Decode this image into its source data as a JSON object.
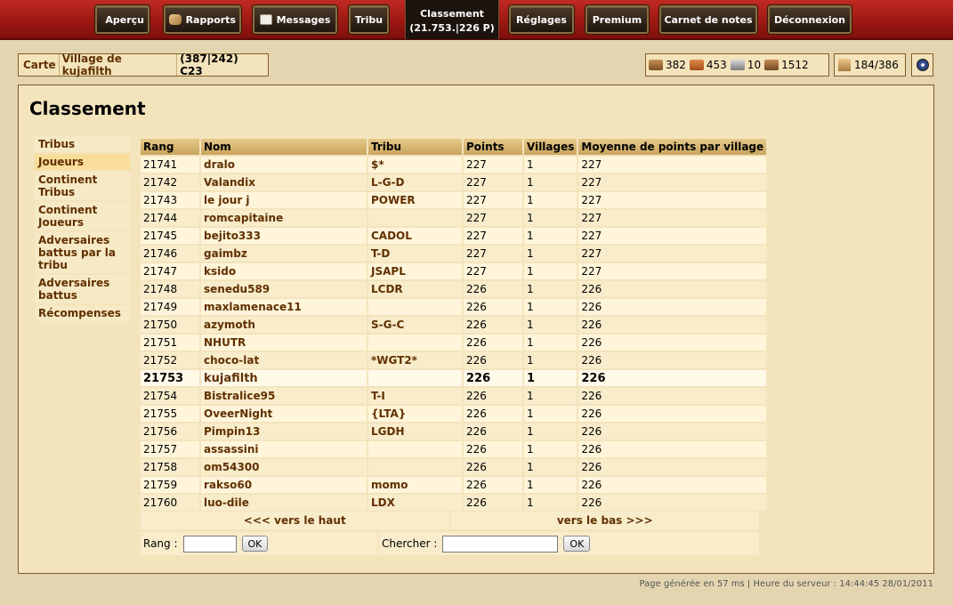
{
  "topbar": {
    "items": [
      {
        "label": "Aperçu"
      },
      {
        "label": "Rapports"
      },
      {
        "label": "Messages"
      },
      {
        "label": "Tribu"
      },
      {
        "label": "Réglages"
      },
      {
        "label": "Premium"
      },
      {
        "label": "Carnet de notes"
      },
      {
        "label": "Déconnexion"
      }
    ],
    "classement": {
      "label": "Classement",
      "sub": "(21.753.|226 P)"
    }
  },
  "village": {
    "map_label": "Carte",
    "village_name": "Village de kujafilth",
    "coords": "(387|242) C23"
  },
  "resources": {
    "wood": "382",
    "clay": "453",
    "iron": "10",
    "storage": "1512"
  },
  "population": "184/386",
  "page": {
    "title": "Classement"
  },
  "side_menu": [
    {
      "label": "Tribus"
    },
    {
      "label": "Joueurs"
    },
    {
      "label": "Continent Tribus"
    },
    {
      "label": "Continent Joueurs"
    },
    {
      "label": "Adversaires battus par la tribu"
    },
    {
      "label": "Adversaires battus"
    },
    {
      "label": "Récompenses"
    }
  ],
  "table": {
    "headers": [
      "Rang",
      "Nom",
      "Tribu",
      "Points",
      "Villages",
      "Moyenne de points par village"
    ],
    "rows": [
      [
        "21741",
        "dralo",
        "$*",
        "227",
        "1",
        "227"
      ],
      [
        "21742",
        "Valandix",
        "L-G-D",
        "227",
        "1",
        "227"
      ],
      [
        "21743",
        "le jour j",
        "POWER",
        "227",
        "1",
        "227"
      ],
      [
        "21744",
        "romcapitaine",
        "",
        "227",
        "1",
        "227"
      ],
      [
        "21745",
        "bejito333",
        "CADOL",
        "227",
        "1",
        "227"
      ],
      [
        "21746",
        "gaimbz",
        "T-D",
        "227",
        "1",
        "227"
      ],
      [
        "21747",
        "ksido",
        "JSAPL",
        "227",
        "1",
        "227"
      ],
      [
        "21748",
        "senedu589",
        "LCDR",
        "226",
        "1",
        "226"
      ],
      [
        "21749",
        "maxlamenace11",
        "",
        "226",
        "1",
        "226"
      ],
      [
        "21750",
        "azymoth",
        "S-G-C",
        "226",
        "1",
        "226"
      ],
      [
        "21751",
        "NHUTR",
        "",
        "226",
        "1",
        "226"
      ],
      [
        "21752",
        "choco-lat",
        "*WGT2*",
        "226",
        "1",
        "226"
      ],
      [
        "21753",
        "kujafilth",
        "",
        "226",
        "1",
        "226"
      ],
      [
        "21754",
        "Bistralice95",
        "T-I",
        "226",
        "1",
        "226"
      ],
      [
        "21755",
        "OveerNight",
        "{LTA}",
        "226",
        "1",
        "226"
      ],
      [
        "21756",
        "Pimpin13",
        "LGDH",
        "226",
        "1",
        "226"
      ],
      [
        "21757",
        "assassini",
        "",
        "226",
        "1",
        "226"
      ],
      [
        "21758",
        "om54300",
        "",
        "226",
        "1",
        "226"
      ],
      [
        "21759",
        "rakso60",
        "momo",
        "226",
        "1",
        "226"
      ],
      [
        "21760",
        "luo-dile",
        "LDX",
        "226",
        "1",
        "226"
      ]
    ]
  },
  "pager": {
    "up": "<<< vers le haut",
    "down": "vers le bas >>>"
  },
  "search": {
    "rank_label": "Rang :",
    "search_label": "Chercher :",
    "ok": "OK",
    "rank_value": "",
    "search_value": ""
  },
  "footer": "Page générée en 57 ms | Heure du serveur : 14:44:45 28/01/2011"
}
